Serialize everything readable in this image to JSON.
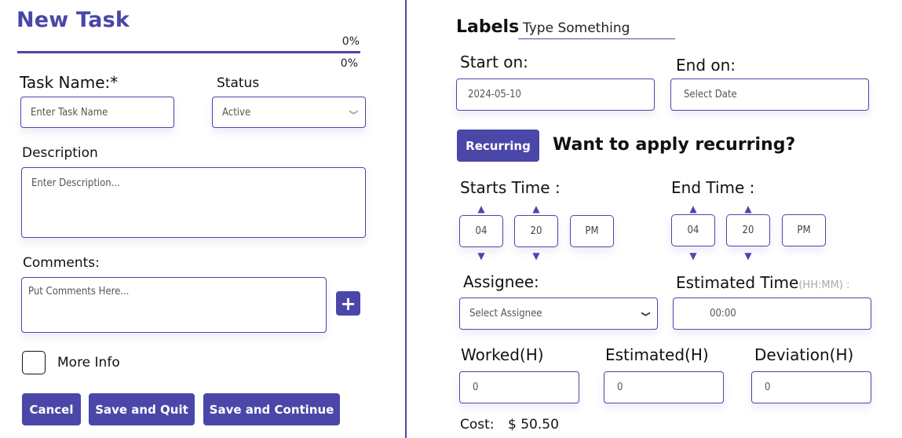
{
  "header": {
    "title": "New Task"
  },
  "progress": {
    "top_label": "0%",
    "bottom_label": "0%",
    "value_percent": 100
  },
  "task_name": {
    "label": "Task Name:*",
    "placeholder": "Enter Task Name"
  },
  "status": {
    "label": "Status",
    "selected": "Active",
    "icon": "chevron-down-icon"
  },
  "description": {
    "label": "Description",
    "placeholder": "Enter Description..."
  },
  "comments": {
    "label": "Comments:",
    "placeholder": "Put Comments Here...",
    "add_icon": "plus-icon",
    "add_symbol": "+"
  },
  "more_info": {
    "label": "More Info",
    "checked": false
  },
  "actions": {
    "cancel": "Cancel",
    "save_quit": "Save and Quit",
    "save_continue": "Save and Continue"
  },
  "labels": {
    "label": "Labels",
    "value": "Type Something"
  },
  "start_on": {
    "label": "Start on:",
    "value": "2024-05-10"
  },
  "end_on": {
    "label": "End on:",
    "placeholder": "Select Date"
  },
  "recurring": {
    "button": "Recurring",
    "prompt": "Want to apply recurring?"
  },
  "start_time": {
    "label": "Starts Time :",
    "hour": "04",
    "minute": "20",
    "period": "PM"
  },
  "end_time": {
    "label": "End Time :",
    "hour": "04",
    "minute": "20",
    "period": "PM"
  },
  "arrows": {
    "up": "⌃",
    "down": "⌄"
  },
  "assignee": {
    "label": "Assignee:",
    "placeholder": "Select Assignee"
  },
  "estimated_time": {
    "label": "Estimated Time",
    "hint": "(HH:MM) :",
    "value": "00:00"
  },
  "worked": {
    "label": "Worked(H)",
    "value": "0"
  },
  "estimated_h": {
    "label": "Estimated(H)",
    "value": "0"
  },
  "deviation": {
    "label": "Deviation(H)",
    "value": "0"
  },
  "cost": {
    "label": "Cost:",
    "value": "$ 50.50"
  },
  "colors": {
    "accent": "#4a47a8"
  }
}
